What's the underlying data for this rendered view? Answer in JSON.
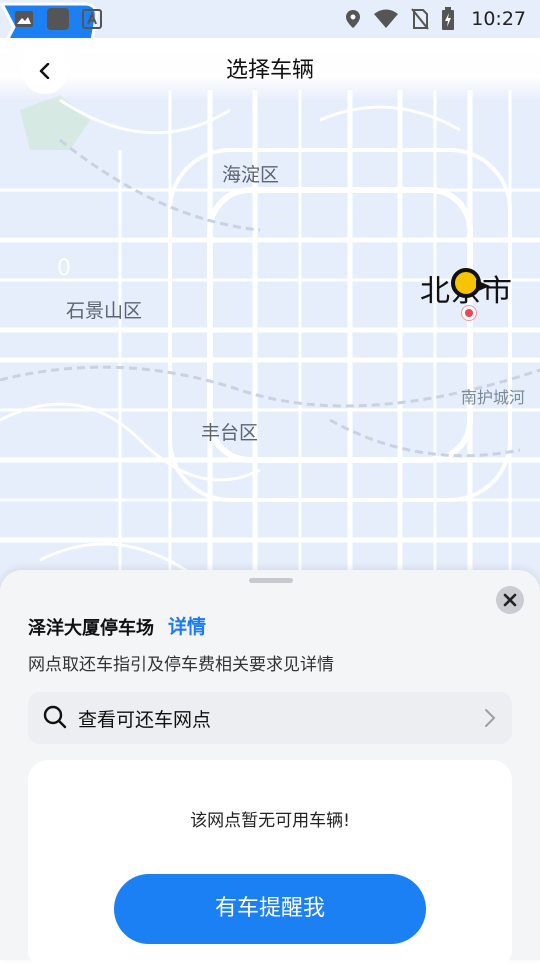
{
  "status_bar": {
    "time": "10:27",
    "left_icons": [
      "image-icon",
      "square-app-icon",
      "text-a-icon"
    ],
    "right_icons": [
      "location-icon",
      "wifi-icon",
      "no-sim-icon",
      "battery-charging-icon"
    ]
  },
  "header": {
    "title": "选择车辆"
  },
  "map": {
    "district_labels": [
      "海淀区",
      "石景山区",
      "丰台区"
    ],
    "city_label": "北京市",
    "river_label": "南护城河",
    "vehicle_count": "0",
    "colors": {
      "map_bg": "#e6edfb",
      "road": "#ffffff",
      "badge": "#1a80f4",
      "marker": "#f7c400"
    }
  },
  "sheet": {
    "lot_name": "泽洋大厦停车场",
    "detail_link": "详情",
    "description": "网点取还车指引及停车费相关要求见详情",
    "search_label": "查看可还车网点",
    "empty_message": "该网点暂无可用车辆!",
    "notify_button": "有车提醒我",
    "colors": {
      "accent": "#1a80f4",
      "sheet_bg": "#f4f5f7"
    }
  }
}
